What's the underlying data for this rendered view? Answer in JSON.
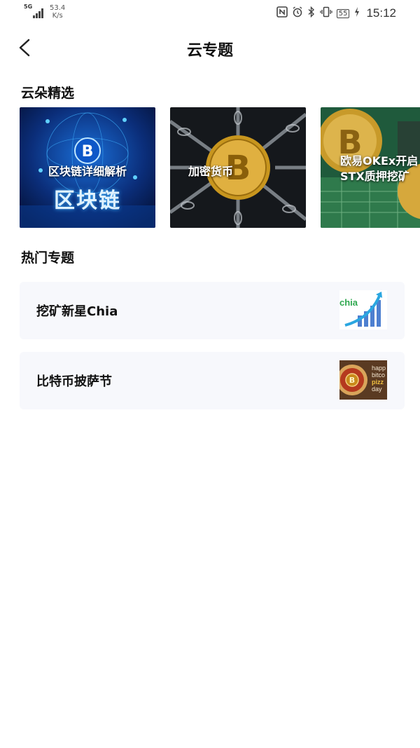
{
  "status_bar": {
    "network": "5G",
    "speed_value": "53.4",
    "speed_unit": "K/s",
    "battery": "55",
    "time": "15:12"
  },
  "header": {
    "title": "云专题"
  },
  "featured": {
    "title": "云朵精选",
    "cards": [
      {
        "label": "区块链详细解析",
        "image_text": "区块链"
      },
      {
        "label": "加密货币"
      },
      {
        "label_line1": "欧易OKEx开启",
        "label_line2": "STX质押挖矿"
      }
    ]
  },
  "hot_topics": {
    "title": "热门专题",
    "items": [
      {
        "label": "挖矿新星Chia",
        "thumb_text": "chia"
      },
      {
        "label": "比特币披萨节",
        "thumb_lines": [
          "happ",
          "bitco",
          "pizz",
          "day"
        ]
      }
    ]
  },
  "colors": {
    "background": "#ffffff",
    "card_surface": "#f7f8fc",
    "text_primary": "#111111",
    "chia_green": "#2fa84f"
  }
}
